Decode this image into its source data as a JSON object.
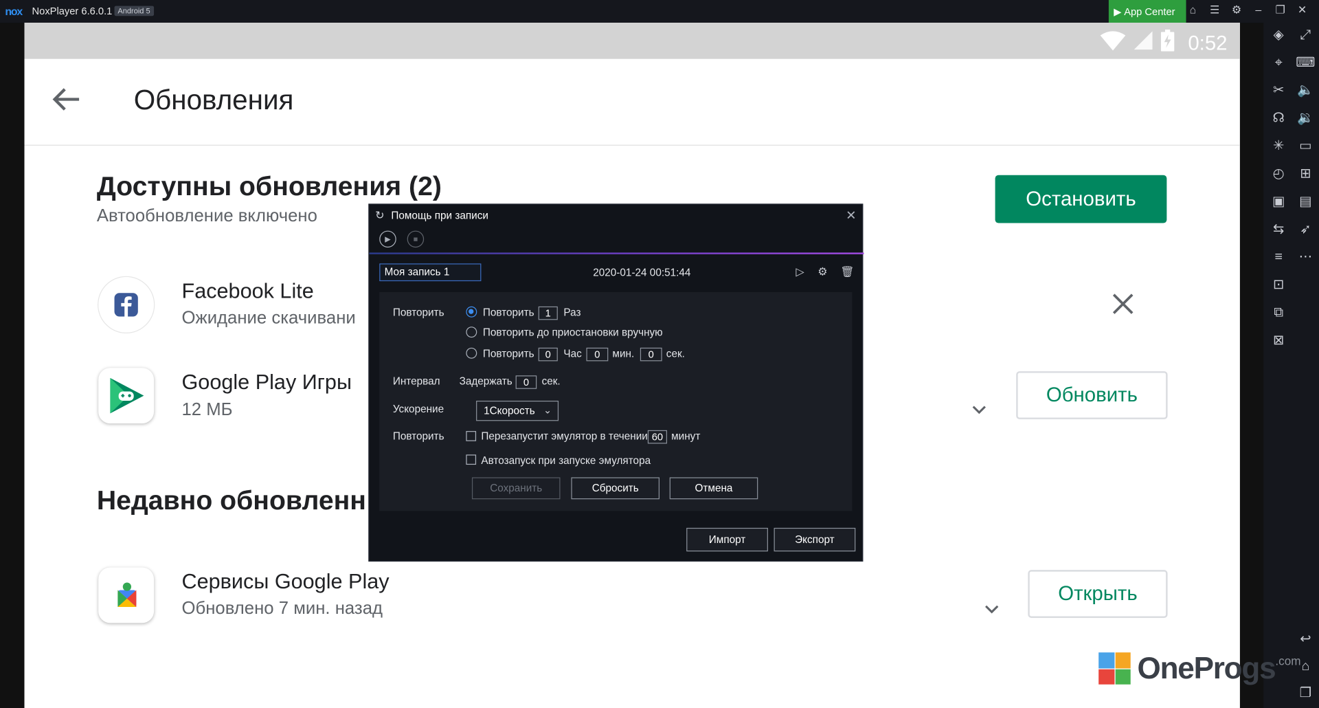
{
  "titlebar": {
    "logo": "nox",
    "app_name": "NoxPlayer 6.6.0.1",
    "android_badge": "Android 5",
    "app_center": "App Center",
    "window_icons": [
      "shirt-icon",
      "menu-icon",
      "gear-icon",
      "minimize-icon",
      "restore-icon",
      "close-icon"
    ]
  },
  "statusbar": {
    "time": "0:52",
    "icons": [
      "wifi-icon",
      "signal-icon",
      "battery-icon"
    ]
  },
  "appbar": {
    "title": "Обновления"
  },
  "available": {
    "title": "Доступны обновления (2)",
    "subtitle": "Автообновление включено",
    "stop_button": "Остановить"
  },
  "apps": [
    {
      "name": "Facebook Lite",
      "sub": "Ожидание скачивани"
    },
    {
      "name": "Google Play Игры",
      "sub": "12 МБ",
      "action": "Обновить"
    }
  ],
  "recent": {
    "title": "Недавно обновленн",
    "apps": [
      {
        "name": "Сервисы Google Play",
        "sub": "Обновлено 7 мин. назад",
        "action": "Открыть"
      }
    ]
  },
  "dialog": {
    "title": "Помощь при записи",
    "record_name": "Моя запись 1",
    "record_date": "2020-01-24 00:51:44",
    "repeat_label": "Повторить",
    "opt1": {
      "prefix": "Повторить",
      "value": "1",
      "suffix": "Раз"
    },
    "opt2": "Повторить до приостановки вручную",
    "opt3": {
      "prefix": "Повторить",
      "hours": "0",
      "hours_unit": "Час",
      "minutes": "0",
      "minutes_unit": "мин.",
      "seconds": "0",
      "seconds_unit": "сек."
    },
    "interval_label": "Интервал",
    "delay_label": "Задержать",
    "delay_value": "0",
    "delay_unit": "сек.",
    "speed_label": "Ускорение",
    "speed_value": "1Скорость",
    "restart_label": "Повторить",
    "restart_text": "Перезапустит эмулятор в течении",
    "restart_value": "60",
    "restart_unit": "минут",
    "autostart_text": "Автозапуск при запуске эмулятора",
    "btn_save": "Сохранить",
    "btn_reset": "Сбросить",
    "btn_cancel": "Отмена",
    "btn_import": "Импорт",
    "btn_export": "Экспорт"
  },
  "watermark": {
    "text": "OneProgs",
    "suffix": ".com"
  },
  "colors": {
    "accent": "#01875f",
    "dialog_bg": "#11141a",
    "panel_bg": "#1b1e25",
    "radio_on": "#3d8ef0",
    "app_center": "#2e9e3e"
  }
}
